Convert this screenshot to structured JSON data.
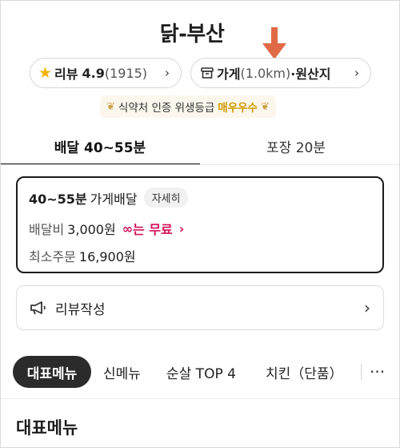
{
  "store": {
    "name": "닭-부산"
  },
  "review_pill": {
    "label": "리뷰",
    "rating": "4.9",
    "count": "(1915)",
    "chevron": "›",
    "icon": "star-icon"
  },
  "store_pill": {
    "label": "가게",
    "distance": "(1.0km)",
    "suffix": "·원산지",
    "chevron": "›",
    "icon": "store-icon"
  },
  "certification": {
    "text": "식약처 인증 위생등급",
    "grade": "매우우수"
  },
  "tabs": [
    {
      "label": "배달 40~55분",
      "active": true
    },
    {
      "label": "포장 20분",
      "active": false
    }
  ],
  "delivery_info": {
    "time": "40~55분",
    "type": "가게배달",
    "detail_button": "자세히",
    "fee_label": "배달비",
    "fee_value": "3,000원",
    "promo_text": "는 무료",
    "promo_chevron": "›",
    "min_order_label": "최소주문",
    "min_order_value": "16,900원"
  },
  "review_write": {
    "label": "리뷰작성",
    "chevron": "›",
    "icon": "megaphone-icon"
  },
  "menu_chips": [
    {
      "label": "대표메뉴",
      "active": true
    },
    {
      "label": "신메뉴",
      "active": false
    },
    {
      "label": "순살 TOP 4",
      "active": false
    },
    {
      "label": "치킨（단품）",
      "active": false
    }
  ],
  "more_chip": "···",
  "section": {
    "title": "대표메뉴"
  },
  "colors": {
    "annotation_arrow": "#e06a45",
    "promo": "#d1125a",
    "grade": "#d19a00",
    "active_chip": "#2b2b2b"
  }
}
